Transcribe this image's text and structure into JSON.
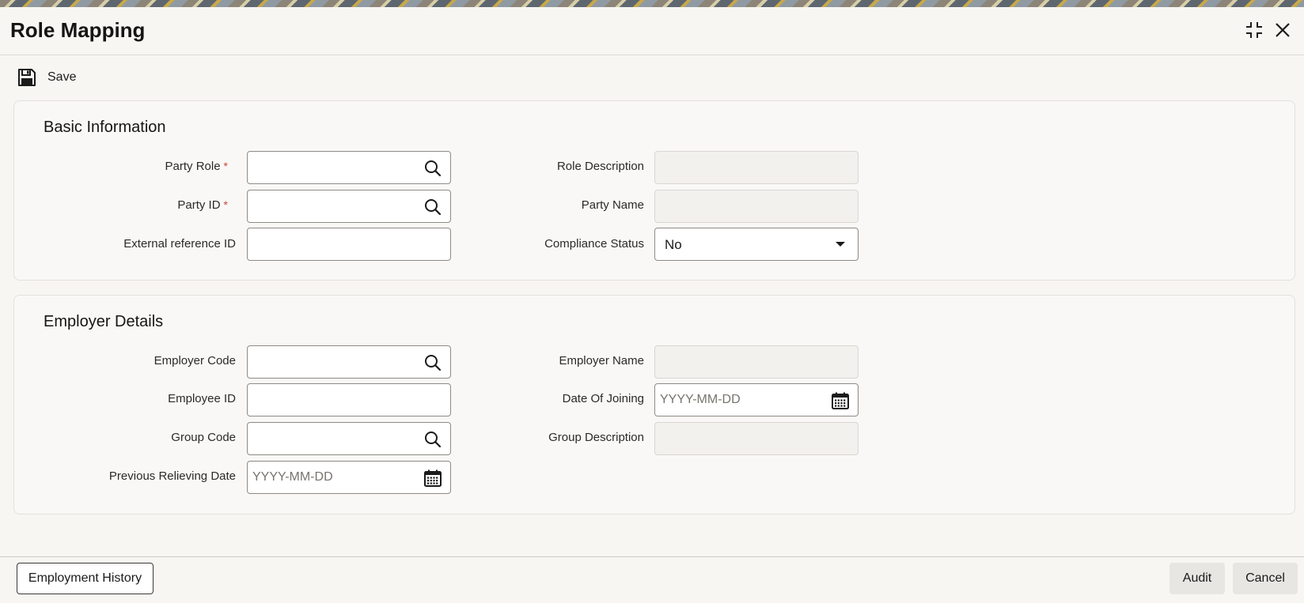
{
  "window": {
    "title": "Role Mapping"
  },
  "toolbar": {
    "save_label": "Save"
  },
  "basic_information": {
    "section_title": "Basic Information",
    "party_role": {
      "label": "Party Role",
      "required_mark": "*",
      "value": ""
    },
    "party_id": {
      "label": "Party ID",
      "required_mark": "*",
      "value": ""
    },
    "external_reference_id": {
      "label": "External reference ID",
      "value": ""
    },
    "role_description": {
      "label": "Role Description",
      "value": ""
    },
    "party_name": {
      "label": "Party Name",
      "value": ""
    },
    "compliance_status": {
      "label": "Compliance Status",
      "value": "No"
    }
  },
  "employer_details": {
    "section_title": "Employer Details",
    "employer_code": {
      "label": "Employer Code",
      "value": ""
    },
    "employee_id": {
      "label": "Employee ID",
      "value": ""
    },
    "group_code": {
      "label": "Group Code",
      "value": ""
    },
    "previous_relieving_date": {
      "label": "Previous Relieving Date",
      "value": "",
      "placeholder": "YYYY-MM-DD"
    },
    "employer_name": {
      "label": "Employer Name",
      "value": ""
    },
    "date_of_joining": {
      "label": "Date Of Joining",
      "value": "",
      "placeholder": "YYYY-MM-DD"
    },
    "group_description": {
      "label": "Group Description",
      "value": ""
    }
  },
  "footer": {
    "employment_history_label": "Employment History",
    "audit_label": "Audit",
    "cancel_label": "Cancel"
  },
  "icons": {
    "maximize": "maximize-icon",
    "close": "close-icon",
    "save": "floppy-disk-icon",
    "lookup": "search-icon",
    "dropdown": "chevron-down-icon",
    "calendar": "calendar-icon"
  },
  "colors": {
    "required_mark": "#c74634",
    "background": "#f7f6f3"
  }
}
